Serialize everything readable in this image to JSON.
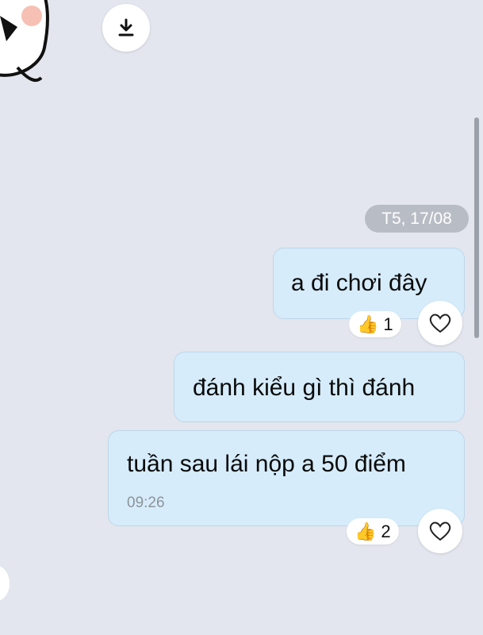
{
  "chat": {
    "date_separator": "T5, 17/08",
    "messages": [
      {
        "text": "a đi chơi đây",
        "reaction": {
          "emoji": "👍",
          "count": "1"
        }
      },
      {
        "text": "đánh kiểu gì thì đánh"
      },
      {
        "text": "tuần sau lái nộp a 50 điểm",
        "time": "09:26",
        "reaction": {
          "emoji": "👍",
          "count": "2"
        }
      }
    ]
  },
  "icons": {
    "download": "download-icon",
    "heart": "heart-outline-icon",
    "thumbs_up": "thumbs-up-emoji",
    "sticker": "cartoon-sticker"
  },
  "colors": {
    "background": "#e3e6ee",
    "sent_bubble": "#d6ecfb",
    "date_pill": "#b7bcc5",
    "timestamp": "#8e9399"
  }
}
